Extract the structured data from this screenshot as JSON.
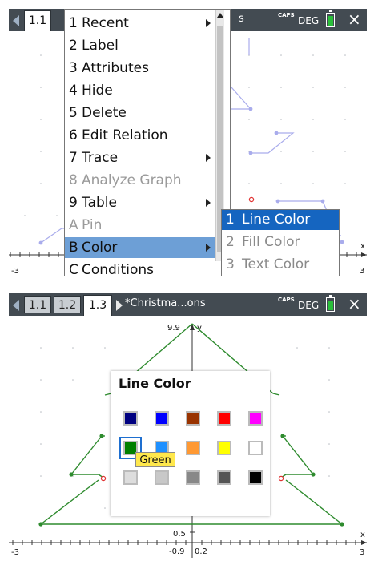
{
  "screen1": {
    "tabs": [
      {
        "label": "1.1",
        "active": true
      }
    ],
    "doc_title_fragment": "s",
    "status": {
      "caps": "CAPS",
      "mode": "DEG",
      "close": "×"
    },
    "menu": {
      "items": [
        {
          "num": "1",
          "label": "Recent",
          "submenu": true,
          "disabled": false
        },
        {
          "num": "2",
          "label": "Label",
          "submenu": false,
          "disabled": false
        },
        {
          "num": "3",
          "label": "Attributes",
          "submenu": false,
          "disabled": false
        },
        {
          "num": "4",
          "label": "Hide",
          "submenu": false,
          "disabled": false
        },
        {
          "num": "5",
          "label": "Delete",
          "submenu": false,
          "disabled": false
        },
        {
          "num": "6",
          "label": "Edit Relation",
          "submenu": false,
          "disabled": false
        },
        {
          "num": "7",
          "label": "Trace",
          "submenu": true,
          "disabled": false
        },
        {
          "num": "8",
          "label": "Analyze Graph",
          "submenu": false,
          "disabled": true
        },
        {
          "num": "9",
          "label": "Table",
          "submenu": true,
          "disabled": false
        },
        {
          "num": "A",
          "label": "Pin",
          "submenu": false,
          "disabled": true
        },
        {
          "num": "B",
          "label": "Color",
          "submenu": true,
          "disabled": false,
          "highlight": true
        },
        {
          "num": "C",
          "label": "Conditions",
          "submenu": true,
          "disabled": false
        }
      ]
    },
    "submenu": {
      "items": [
        {
          "num": "1",
          "label": "Line Color",
          "highlight": true
        },
        {
          "num": "2",
          "label": "Fill Color",
          "highlight": false
        },
        {
          "num": "3",
          "label": "Text Color",
          "highlight": false
        }
      ]
    },
    "axis": {
      "xmin_label": "-3",
      "xmax_label": "3",
      "x_axis_label": "x"
    }
  },
  "screen2": {
    "tabs": [
      {
        "label": "1.1",
        "active": false
      },
      {
        "label": "1.2",
        "active": false
      },
      {
        "label": "1.3",
        "active": true
      }
    ],
    "doc_title": "*Christma...ons",
    "status": {
      "caps": "CAPS",
      "mode": "DEG",
      "close": "×"
    },
    "palette": {
      "title": "Line Color",
      "colors": [
        [
          "#000080",
          "#0000ff",
          "#993300",
          "#ff0000",
          "#ff00ff"
        ],
        [
          "#008000",
          "#1e90ff",
          "#ff9933",
          "#ffff00",
          "#ffffff"
        ],
        [
          "#dddddd",
          "#c8c8c8",
          "#888888",
          "#555555",
          "#000000"
        ]
      ],
      "selected_name": "Green"
    },
    "axis": {
      "ymax_label": "9.9",
      "y_axis_label": "y",
      "xmin_label": "-3",
      "xmax_label": "3",
      "x_axis_label": "x",
      "tick_label_y": "0.5",
      "ymin_label": "-0.9",
      "x_tick_label": "0.2"
    }
  }
}
